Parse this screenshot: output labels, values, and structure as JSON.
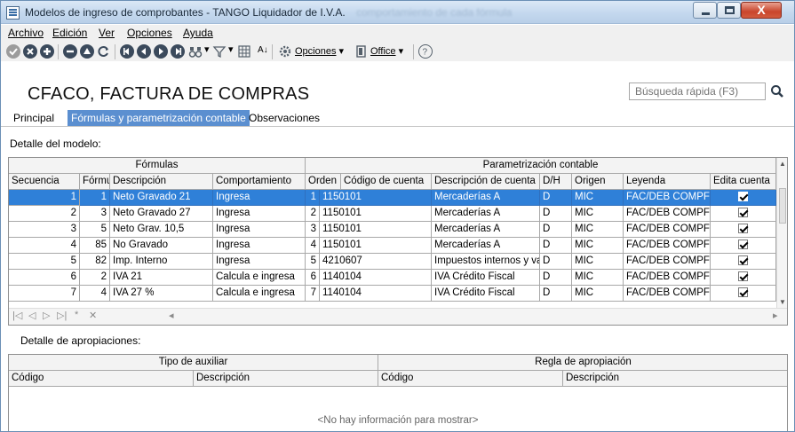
{
  "window": {
    "title": "Modelos de ingreso de comprobantes - TANGO Liquidador de I.V.A.",
    "title_ghost": "comportamiento de cada fórmula",
    "close_glyph": "X"
  },
  "menu": [
    {
      "label": "Archivo"
    },
    {
      "label": "Edición"
    },
    {
      "label": "Ver"
    },
    {
      "label": "Opciones"
    },
    {
      "label": "Ayuda"
    }
  ],
  "toolbar": {
    "options_label": "Opciones",
    "office_label": "Office",
    "sort_label": "A↓",
    "icons": [
      "check-icon",
      "cancel-icon",
      "add-icon",
      "delete-icon",
      "edit-icon",
      "refresh-icon",
      "first-record-icon",
      "previous-record-icon",
      "next-record-icon",
      "last-record-icon",
      "binoculars-icon",
      "filter-icon",
      "grid-icon",
      "sort-icon",
      "gear-icon",
      "office-icon",
      "help-icon"
    ]
  },
  "header": {
    "title": "CFACO, FACTURA DE  COMPRAS",
    "search_placeholder": "Búsqueda rápida (F3)"
  },
  "tabs": [
    {
      "label": "Principal",
      "active": false
    },
    {
      "label": "Fórmulas y parametrización contable",
      "active": true
    },
    {
      "label": "Observaciones",
      "active": false
    }
  ],
  "detail_label": "Detalle del modelo:",
  "grid": {
    "group_headers": [
      "Fórmulas",
      "Parametrización contable"
    ],
    "columns": [
      "Secuencia",
      "Fórmula",
      "Descripción",
      "Comportamiento",
      "Orden",
      "Código de cuenta",
      "Descripción de cuenta",
      "D/H",
      "Origen",
      "Leyenda",
      "Edita cuenta"
    ],
    "rows": [
      {
        "secuencia": "1",
        "formula": "1",
        "descripcion": "Neto Gravado 21",
        "comportamiento": "Ingresa",
        "orden": "1",
        "codigo": "1150101",
        "desc_cuenta": "Mercaderías A",
        "dh": "D",
        "origen": "MIC",
        "leyenda": "FAC/DEB COMPF",
        "edita": true,
        "selected": true
      },
      {
        "secuencia": "2",
        "formula": "3",
        "descripcion": "Neto Gravado 27",
        "comportamiento": "Ingresa",
        "orden": "2",
        "codigo": "1150101",
        "desc_cuenta": "Mercaderías A",
        "dh": "D",
        "origen": "MIC",
        "leyenda": "FAC/DEB COMPF",
        "edita": true,
        "selected": false
      },
      {
        "secuencia": "3",
        "formula": "5",
        "descripcion": "Neto Grav. 10,5",
        "comportamiento": "Ingresa",
        "orden": "3",
        "codigo": "1150101",
        "desc_cuenta": "Mercaderías A",
        "dh": "D",
        "origen": "MIC",
        "leyenda": "FAC/DEB COMPF",
        "edita": true,
        "selected": false
      },
      {
        "secuencia": "4",
        "formula": "85",
        "descripcion": "No Gravado",
        "comportamiento": "Ingresa",
        "orden": "4",
        "codigo": "1150101",
        "desc_cuenta": "Mercaderías A",
        "dh": "D",
        "origen": "MIC",
        "leyenda": "FAC/DEB COMPF",
        "edita": true,
        "selected": false
      },
      {
        "secuencia": "5",
        "formula": "82",
        "descripcion": "Imp. Interno",
        "comportamiento": "Ingresa",
        "orden": "5",
        "codigo": "4210607",
        "desc_cuenta": "Impuestos internos y va",
        "dh": "D",
        "origen": "MIC",
        "leyenda": "FAC/DEB COMPF",
        "edita": true,
        "selected": false
      },
      {
        "secuencia": "6",
        "formula": "2",
        "descripcion": "IVA 21",
        "comportamiento": "Calcula e ingresa",
        "orden": "6",
        "codigo": "1140104",
        "desc_cuenta": "IVA Crédito Fiscal",
        "dh": "D",
        "origen": "MIC",
        "leyenda": "FAC/DEB COMPF",
        "edita": true,
        "selected": false
      },
      {
        "secuencia": "7",
        "formula": "4",
        "descripcion": "IVA 27 %",
        "comportamiento": "Calcula e ingresa",
        "orden": "7",
        "codigo": "1140104",
        "desc_cuenta": "IVA Crédito Fiscal",
        "dh": "D",
        "origen": "MIC",
        "leyenda": "FAC/DEB COMPF",
        "edita": true,
        "selected": false
      }
    ],
    "nav": [
      "|◁",
      "◁",
      "▷",
      "▷|",
      "*",
      "✕"
    ]
  },
  "apropiaciones": {
    "label": "Detalle de apropiaciones:",
    "group_headers": [
      "Tipo de auxiliar",
      "Regla de apropiación"
    ],
    "columns": [
      "Código",
      "Descripción",
      "Código",
      "Descripción"
    ],
    "empty_text": "<No hay información para mostrar>"
  }
}
